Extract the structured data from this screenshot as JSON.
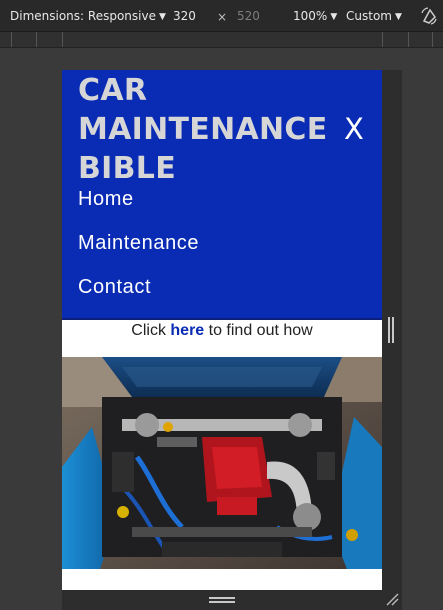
{
  "devtools": {
    "dimensions_label": "Dimensions: Responsive",
    "width": "320",
    "times": "×",
    "height": "520",
    "zoom": "100%",
    "throttle": "Custom",
    "rotate_icon": "rotate-icon"
  },
  "site": {
    "logo_lines": [
      "CAR",
      "MAINTENANCE",
      "BIBLE"
    ],
    "close_label": "X",
    "nav": [
      "Home",
      "Maintenance",
      "Contact"
    ],
    "cta": {
      "before": "Click ",
      "link": "here",
      "after": " to find out how"
    },
    "hero_alt": "engine bay photo",
    "colors": {
      "header_bg": "#0a2bb3",
      "logo": "#d6d6d6",
      "link": "#0a2bb3"
    }
  }
}
